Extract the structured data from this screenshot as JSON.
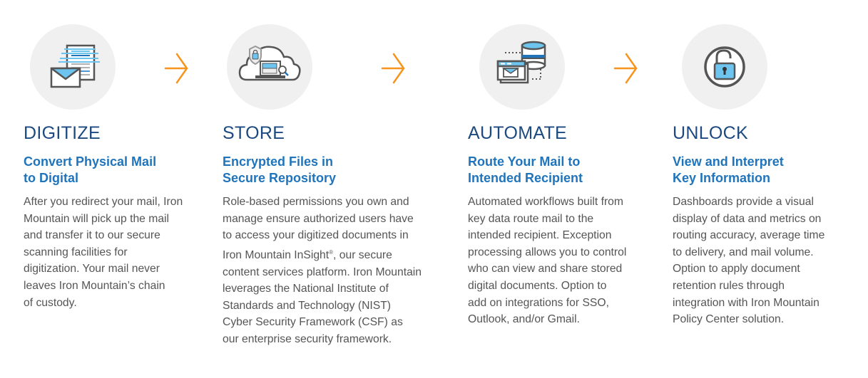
{
  "colors": {
    "heading": "#1c4a80",
    "subheading": "#1f74bb",
    "body": "#555555",
    "arrow": "#f7941d",
    "icon_circle": "#f0f0f0",
    "icon_accent": "#6cc4ef",
    "icon_stroke": "#555555"
  },
  "steps": [
    {
      "icon": "mail-scan-icon",
      "title": "DIGITIZE",
      "subtitle": "Convert Physical Mail\nto Digital",
      "body": "After you redirect your mail, Iron\nMountain will pick up the mail\nand transfer it to our secure\nscanning facilities for\ndigitization. Your mail never\nleaves Iron Mountain’s chain\nof custody."
    },
    {
      "icon": "cloud-secure-storage-icon",
      "title": "STORE",
      "subtitle": "Encrypted Files in\nSecure Repository",
      "body_before_mark": "Role-based permissions you own and\nmanage ensure authorized users have\nto access your digitized documents in\nIron Mountain InSight",
      "registered_mark": "®",
      "body_after_mark": ", our secure\ncontent services platform. Iron Mountain\nleverages the National Institute of\nStandards and Technology (NIST)\nCyber Security Framework (CSF) as\nour enterprise security framework."
    },
    {
      "icon": "mail-database-routing-icon",
      "title": "AUTOMATE",
      "subtitle": "Route Your Mail to\nIntended Recipient",
      "body": "Automated workflows built from\nkey data route mail to the\nintended recipient. Exception\nprocessing allows you to control\nwho can view and share stored\ndigital documents. Option to\nadd on integrations for SSO,\nOutlook, and/or Gmail."
    },
    {
      "icon": "unlocked-padlock-icon",
      "title": "UNLOCK",
      "subtitle": "View and Interpret\nKey Information",
      "body": "Dashboards provide a visual\ndisplay of data and metrics on\nrouting accuracy, average time\nto delivery, and mail volume.\nOption to apply document\nretention rules through\nintegration with Iron Mountain\nPolicy Center solution."
    }
  ],
  "arrows": [
    "arrow-right-icon",
    "arrow-right-icon",
    "arrow-right-icon"
  ]
}
